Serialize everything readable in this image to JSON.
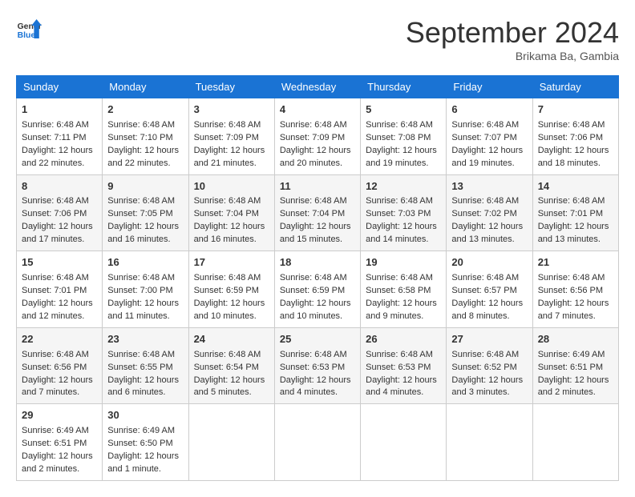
{
  "header": {
    "logo_line1": "General",
    "logo_line2": "Blue",
    "month": "September 2024",
    "location": "Brikama Ba, Gambia"
  },
  "weekdays": [
    "Sunday",
    "Monday",
    "Tuesday",
    "Wednesday",
    "Thursday",
    "Friday",
    "Saturday"
  ],
  "weeks": [
    [
      {
        "day": "1",
        "lines": [
          "Sunrise: 6:48 AM",
          "Sunset: 7:11 PM",
          "Daylight: 12 hours",
          "and 22 minutes."
        ]
      },
      {
        "day": "2",
        "lines": [
          "Sunrise: 6:48 AM",
          "Sunset: 7:10 PM",
          "Daylight: 12 hours",
          "and 22 minutes."
        ]
      },
      {
        "day": "3",
        "lines": [
          "Sunrise: 6:48 AM",
          "Sunset: 7:09 PM",
          "Daylight: 12 hours",
          "and 21 minutes."
        ]
      },
      {
        "day": "4",
        "lines": [
          "Sunrise: 6:48 AM",
          "Sunset: 7:09 PM",
          "Daylight: 12 hours",
          "and 20 minutes."
        ]
      },
      {
        "day": "5",
        "lines": [
          "Sunrise: 6:48 AM",
          "Sunset: 7:08 PM",
          "Daylight: 12 hours",
          "and 19 minutes."
        ]
      },
      {
        "day": "6",
        "lines": [
          "Sunrise: 6:48 AM",
          "Sunset: 7:07 PM",
          "Daylight: 12 hours",
          "and 19 minutes."
        ]
      },
      {
        "day": "7",
        "lines": [
          "Sunrise: 6:48 AM",
          "Sunset: 7:06 PM",
          "Daylight: 12 hours",
          "and 18 minutes."
        ]
      }
    ],
    [
      {
        "day": "8",
        "lines": [
          "Sunrise: 6:48 AM",
          "Sunset: 7:06 PM",
          "Daylight: 12 hours",
          "and 17 minutes."
        ]
      },
      {
        "day": "9",
        "lines": [
          "Sunrise: 6:48 AM",
          "Sunset: 7:05 PM",
          "Daylight: 12 hours",
          "and 16 minutes."
        ]
      },
      {
        "day": "10",
        "lines": [
          "Sunrise: 6:48 AM",
          "Sunset: 7:04 PM",
          "Daylight: 12 hours",
          "and 16 minutes."
        ]
      },
      {
        "day": "11",
        "lines": [
          "Sunrise: 6:48 AM",
          "Sunset: 7:04 PM",
          "Daylight: 12 hours",
          "and 15 minutes."
        ]
      },
      {
        "day": "12",
        "lines": [
          "Sunrise: 6:48 AM",
          "Sunset: 7:03 PM",
          "Daylight: 12 hours",
          "and 14 minutes."
        ]
      },
      {
        "day": "13",
        "lines": [
          "Sunrise: 6:48 AM",
          "Sunset: 7:02 PM",
          "Daylight: 12 hours",
          "and 13 minutes."
        ]
      },
      {
        "day": "14",
        "lines": [
          "Sunrise: 6:48 AM",
          "Sunset: 7:01 PM",
          "Daylight: 12 hours",
          "and 13 minutes."
        ]
      }
    ],
    [
      {
        "day": "15",
        "lines": [
          "Sunrise: 6:48 AM",
          "Sunset: 7:01 PM",
          "Daylight: 12 hours",
          "and 12 minutes."
        ]
      },
      {
        "day": "16",
        "lines": [
          "Sunrise: 6:48 AM",
          "Sunset: 7:00 PM",
          "Daylight: 12 hours",
          "and 11 minutes."
        ]
      },
      {
        "day": "17",
        "lines": [
          "Sunrise: 6:48 AM",
          "Sunset: 6:59 PM",
          "Daylight: 12 hours",
          "and 10 minutes."
        ]
      },
      {
        "day": "18",
        "lines": [
          "Sunrise: 6:48 AM",
          "Sunset: 6:59 PM",
          "Daylight: 12 hours",
          "and 10 minutes."
        ]
      },
      {
        "day": "19",
        "lines": [
          "Sunrise: 6:48 AM",
          "Sunset: 6:58 PM",
          "Daylight: 12 hours",
          "and 9 minutes."
        ]
      },
      {
        "day": "20",
        "lines": [
          "Sunrise: 6:48 AM",
          "Sunset: 6:57 PM",
          "Daylight: 12 hours",
          "and 8 minutes."
        ]
      },
      {
        "day": "21",
        "lines": [
          "Sunrise: 6:48 AM",
          "Sunset: 6:56 PM",
          "Daylight: 12 hours",
          "and 7 minutes."
        ]
      }
    ],
    [
      {
        "day": "22",
        "lines": [
          "Sunrise: 6:48 AM",
          "Sunset: 6:56 PM",
          "Daylight: 12 hours",
          "and 7 minutes."
        ]
      },
      {
        "day": "23",
        "lines": [
          "Sunrise: 6:48 AM",
          "Sunset: 6:55 PM",
          "Daylight: 12 hours",
          "and 6 minutes."
        ]
      },
      {
        "day": "24",
        "lines": [
          "Sunrise: 6:48 AM",
          "Sunset: 6:54 PM",
          "Daylight: 12 hours",
          "and 5 minutes."
        ]
      },
      {
        "day": "25",
        "lines": [
          "Sunrise: 6:48 AM",
          "Sunset: 6:53 PM",
          "Daylight: 12 hours",
          "and 4 minutes."
        ]
      },
      {
        "day": "26",
        "lines": [
          "Sunrise: 6:48 AM",
          "Sunset: 6:53 PM",
          "Daylight: 12 hours",
          "and 4 minutes."
        ]
      },
      {
        "day": "27",
        "lines": [
          "Sunrise: 6:48 AM",
          "Sunset: 6:52 PM",
          "Daylight: 12 hours",
          "and 3 minutes."
        ]
      },
      {
        "day": "28",
        "lines": [
          "Sunrise: 6:49 AM",
          "Sunset: 6:51 PM",
          "Daylight: 12 hours",
          "and 2 minutes."
        ]
      }
    ],
    [
      {
        "day": "29",
        "lines": [
          "Sunrise: 6:49 AM",
          "Sunset: 6:51 PM",
          "Daylight: 12 hours",
          "and 2 minutes."
        ]
      },
      {
        "day": "30",
        "lines": [
          "Sunrise: 6:49 AM",
          "Sunset: 6:50 PM",
          "Daylight: 12 hours",
          "and 1 minute."
        ]
      },
      null,
      null,
      null,
      null,
      null
    ]
  ]
}
